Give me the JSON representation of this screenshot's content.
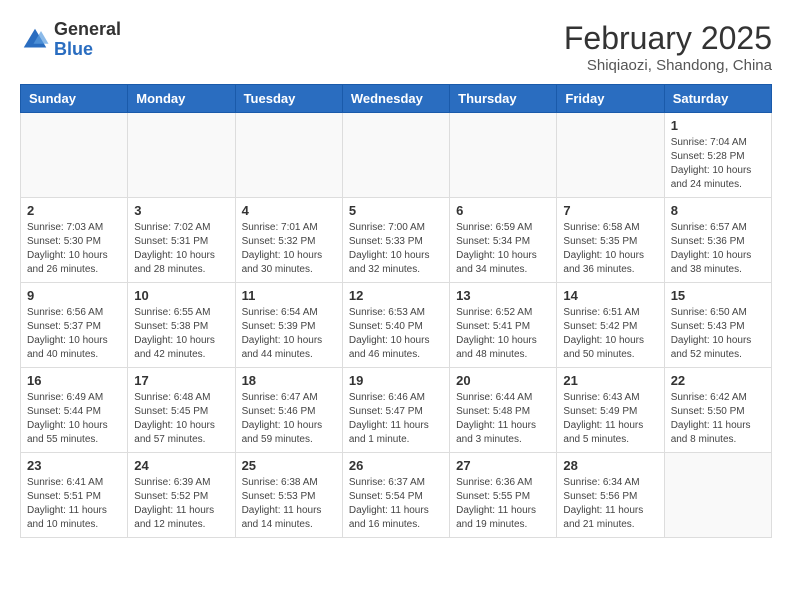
{
  "logo": {
    "general": "General",
    "blue": "Blue"
  },
  "header": {
    "month": "February 2025",
    "location": "Shiqiaozi, Shandong, China"
  },
  "weekdays": [
    "Sunday",
    "Monday",
    "Tuesday",
    "Wednesday",
    "Thursday",
    "Friday",
    "Saturday"
  ],
  "weeks": [
    [
      {
        "day": "",
        "info": ""
      },
      {
        "day": "",
        "info": ""
      },
      {
        "day": "",
        "info": ""
      },
      {
        "day": "",
        "info": ""
      },
      {
        "day": "",
        "info": ""
      },
      {
        "day": "",
        "info": ""
      },
      {
        "day": "1",
        "info": "Sunrise: 7:04 AM\nSunset: 5:28 PM\nDaylight: 10 hours and 24 minutes."
      }
    ],
    [
      {
        "day": "2",
        "info": "Sunrise: 7:03 AM\nSunset: 5:30 PM\nDaylight: 10 hours and 26 minutes."
      },
      {
        "day": "3",
        "info": "Sunrise: 7:02 AM\nSunset: 5:31 PM\nDaylight: 10 hours and 28 minutes."
      },
      {
        "day": "4",
        "info": "Sunrise: 7:01 AM\nSunset: 5:32 PM\nDaylight: 10 hours and 30 minutes."
      },
      {
        "day": "5",
        "info": "Sunrise: 7:00 AM\nSunset: 5:33 PM\nDaylight: 10 hours and 32 minutes."
      },
      {
        "day": "6",
        "info": "Sunrise: 6:59 AM\nSunset: 5:34 PM\nDaylight: 10 hours and 34 minutes."
      },
      {
        "day": "7",
        "info": "Sunrise: 6:58 AM\nSunset: 5:35 PM\nDaylight: 10 hours and 36 minutes."
      },
      {
        "day": "8",
        "info": "Sunrise: 6:57 AM\nSunset: 5:36 PM\nDaylight: 10 hours and 38 minutes."
      }
    ],
    [
      {
        "day": "9",
        "info": "Sunrise: 6:56 AM\nSunset: 5:37 PM\nDaylight: 10 hours and 40 minutes."
      },
      {
        "day": "10",
        "info": "Sunrise: 6:55 AM\nSunset: 5:38 PM\nDaylight: 10 hours and 42 minutes."
      },
      {
        "day": "11",
        "info": "Sunrise: 6:54 AM\nSunset: 5:39 PM\nDaylight: 10 hours and 44 minutes."
      },
      {
        "day": "12",
        "info": "Sunrise: 6:53 AM\nSunset: 5:40 PM\nDaylight: 10 hours and 46 minutes."
      },
      {
        "day": "13",
        "info": "Sunrise: 6:52 AM\nSunset: 5:41 PM\nDaylight: 10 hours and 48 minutes."
      },
      {
        "day": "14",
        "info": "Sunrise: 6:51 AM\nSunset: 5:42 PM\nDaylight: 10 hours and 50 minutes."
      },
      {
        "day": "15",
        "info": "Sunrise: 6:50 AM\nSunset: 5:43 PM\nDaylight: 10 hours and 52 minutes."
      }
    ],
    [
      {
        "day": "16",
        "info": "Sunrise: 6:49 AM\nSunset: 5:44 PM\nDaylight: 10 hours and 55 minutes."
      },
      {
        "day": "17",
        "info": "Sunrise: 6:48 AM\nSunset: 5:45 PM\nDaylight: 10 hours and 57 minutes."
      },
      {
        "day": "18",
        "info": "Sunrise: 6:47 AM\nSunset: 5:46 PM\nDaylight: 10 hours and 59 minutes."
      },
      {
        "day": "19",
        "info": "Sunrise: 6:46 AM\nSunset: 5:47 PM\nDaylight: 11 hours and 1 minute."
      },
      {
        "day": "20",
        "info": "Sunrise: 6:44 AM\nSunset: 5:48 PM\nDaylight: 11 hours and 3 minutes."
      },
      {
        "day": "21",
        "info": "Sunrise: 6:43 AM\nSunset: 5:49 PM\nDaylight: 11 hours and 5 minutes."
      },
      {
        "day": "22",
        "info": "Sunrise: 6:42 AM\nSunset: 5:50 PM\nDaylight: 11 hours and 8 minutes."
      }
    ],
    [
      {
        "day": "23",
        "info": "Sunrise: 6:41 AM\nSunset: 5:51 PM\nDaylight: 11 hours and 10 minutes."
      },
      {
        "day": "24",
        "info": "Sunrise: 6:39 AM\nSunset: 5:52 PM\nDaylight: 11 hours and 12 minutes."
      },
      {
        "day": "25",
        "info": "Sunrise: 6:38 AM\nSunset: 5:53 PM\nDaylight: 11 hours and 14 minutes."
      },
      {
        "day": "26",
        "info": "Sunrise: 6:37 AM\nSunset: 5:54 PM\nDaylight: 11 hours and 16 minutes."
      },
      {
        "day": "27",
        "info": "Sunrise: 6:36 AM\nSunset: 5:55 PM\nDaylight: 11 hours and 19 minutes."
      },
      {
        "day": "28",
        "info": "Sunrise: 6:34 AM\nSunset: 5:56 PM\nDaylight: 11 hours and 21 minutes."
      },
      {
        "day": "",
        "info": ""
      }
    ]
  ]
}
